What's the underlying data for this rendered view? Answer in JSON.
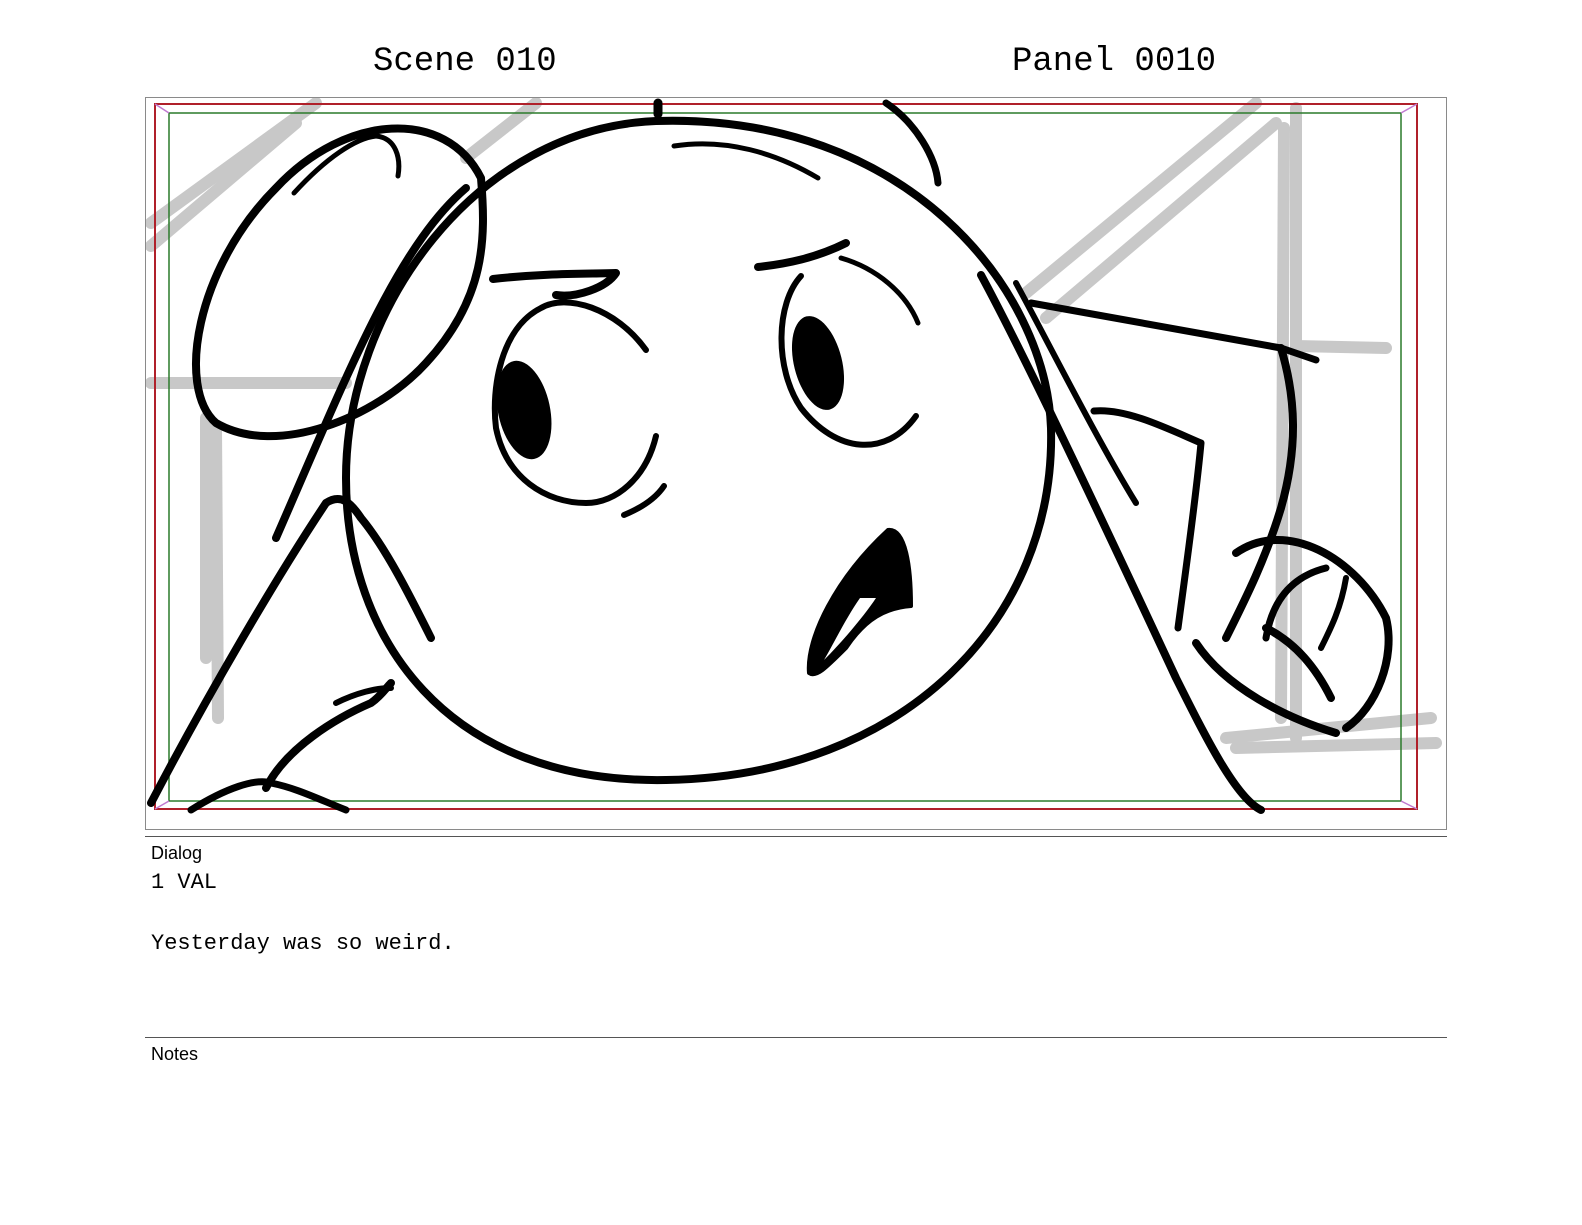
{
  "header": {
    "scene": "Scene 010",
    "panel": "Panel 0010"
  },
  "dialog": {
    "label": "Dialog",
    "character": "1 VAL",
    "line": "Yesterday was so weird."
  },
  "notes": {
    "label": "Notes",
    "text": ""
  },
  "colors": {
    "action_safe": "#b0202a",
    "title_safe": "#2a7a2a",
    "guide_corner": "#c07ad0",
    "construction": "#c8c8c8",
    "ink": "#000000"
  }
}
